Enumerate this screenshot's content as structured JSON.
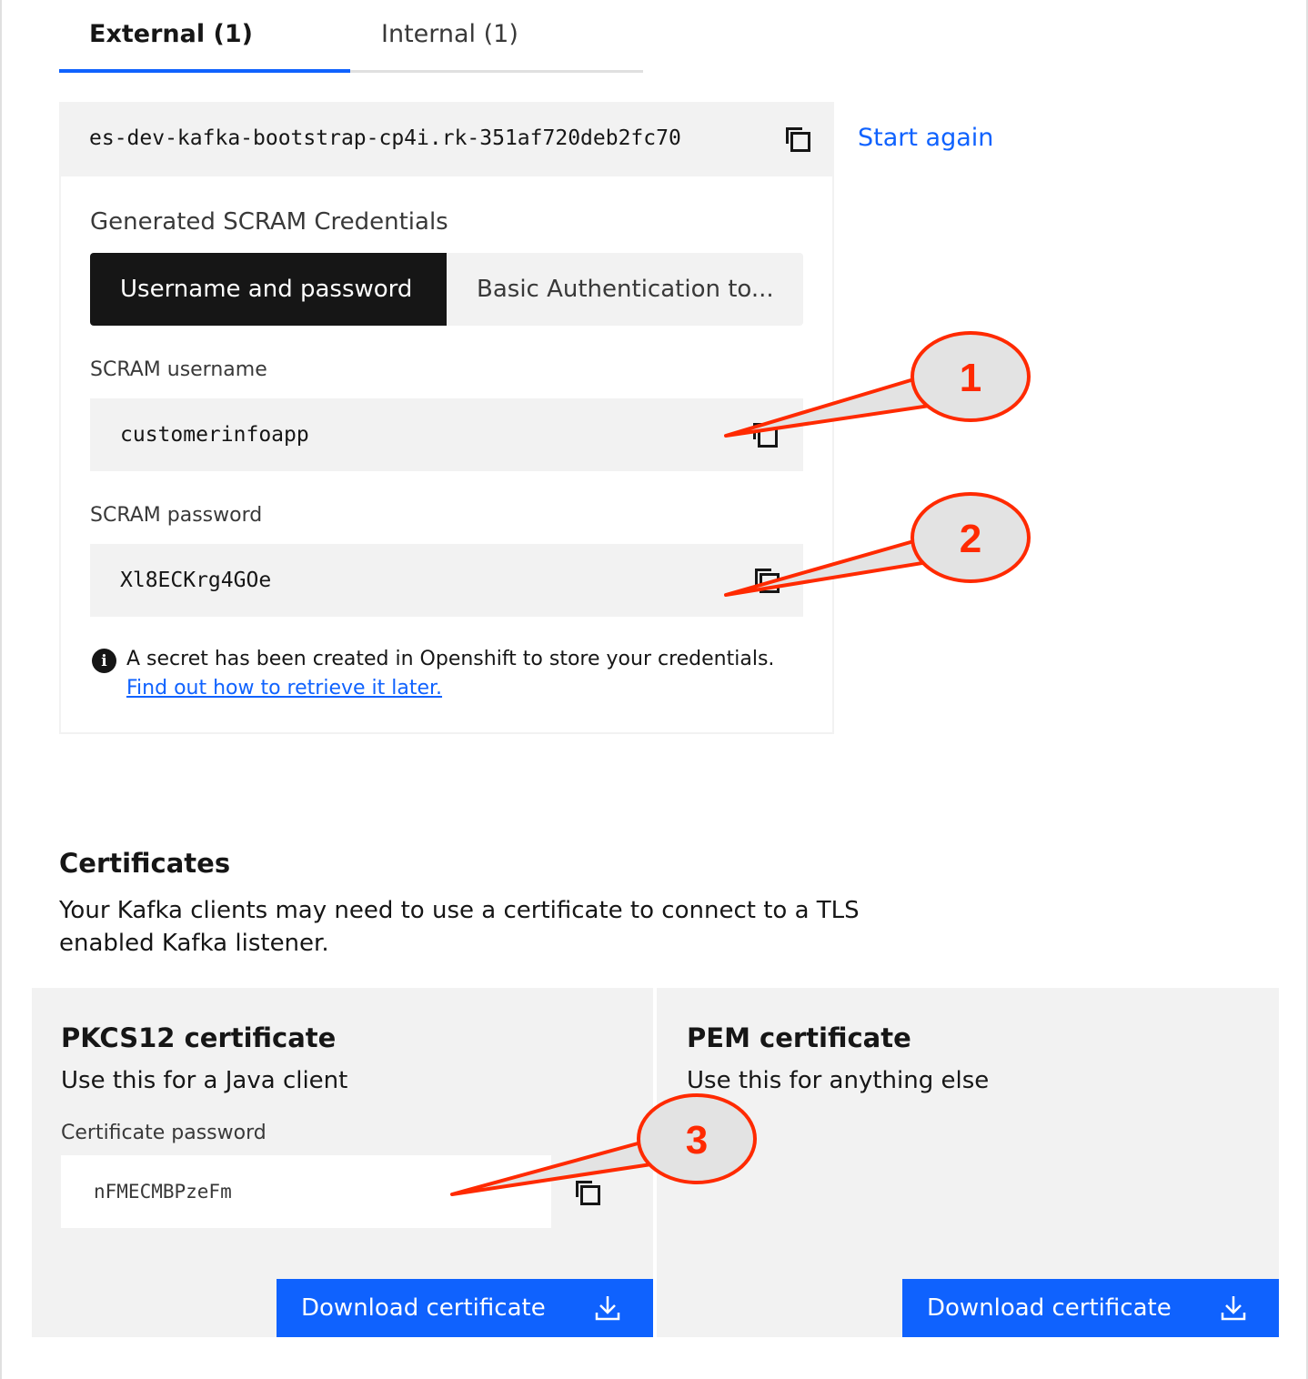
{
  "tabs": [
    {
      "label": "External (1)",
      "active": true
    },
    {
      "label": "Internal (1)",
      "active": false
    }
  ],
  "endpoint": {
    "value": "es-dev-kafka-bootstrap-cp4i.rk-351af720deb2fc70",
    "copy_icon": "copy-icon"
  },
  "start_again_label": "Start again",
  "credentials": {
    "title": "Generated SCRAM Credentials",
    "switcher": [
      {
        "label": "Username and password",
        "selected": true
      },
      {
        "label": "Basic Authentication to...",
        "selected": false
      }
    ],
    "username_label": "SCRAM username",
    "username_value": "customerinfoapp",
    "password_label": "SCRAM password",
    "password_value": "Xl8ECKrg4GOe",
    "info_text": "A secret has been created in Openshift to store your credentials.",
    "info_link": "Find out how to retrieve it later.",
    "info_icon": "information-icon"
  },
  "certificates": {
    "heading": "Certificates",
    "description": "Your Kafka clients may need to use a certificate to connect to a TLS enabled Kafka listener.",
    "pkcs12": {
      "title": "PKCS12 certificate",
      "subtitle": "Use this for a Java client",
      "password_label": "Certificate password",
      "password_value": "nFMECMBPzeFm",
      "download_label": "Download certificate"
    },
    "pem": {
      "title": "PEM certificate",
      "subtitle": "Use this for anything else",
      "download_label": "Download certificate"
    }
  },
  "annotations": [
    {
      "number": "1"
    },
    {
      "number": "2"
    },
    {
      "number": "3"
    }
  ],
  "colors": {
    "accent": "#0f62fe",
    "annotation": "#ff2a00",
    "callout_fill": "#e3e3e3"
  }
}
